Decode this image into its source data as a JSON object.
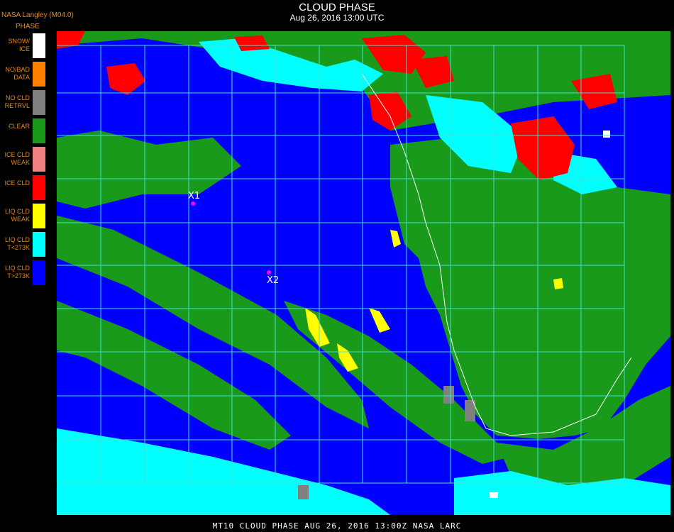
{
  "header": {
    "title": "CLOUD PHASE",
    "date": "Aug 26, 2016 13:00 UTC",
    "source": "NASA Langley (M04.0)"
  },
  "legend": {
    "title": "PHASE",
    "items": [
      {
        "label": "SNOW/\nICE",
        "color": "#ffffff"
      },
      {
        "label": "NO/BAD\nDATA",
        "color": "#ff8000"
      },
      {
        "label": "NO CLD\nRETRVL",
        "color": "#808080"
      },
      {
        "label": "CLEAR",
        "color": "#1a9a1a"
      },
      {
        "label": "ICE CLD\nWEAK",
        "color": "#f08080"
      },
      {
        "label": "ICE CLD",
        "color": "#ff0000"
      },
      {
        "label": "LIQ CLD\nWEAK",
        "color": "#ffff00"
      },
      {
        "label": "LIQ CLD\nT<273K",
        "color": "#00ffff"
      },
      {
        "label": "LIQ CLD\nT>273K",
        "color": "#0000ff"
      }
    ]
  },
  "sites": [
    {
      "label": "X1"
    },
    {
      "label": "X2"
    }
  ],
  "footer": "MT10  CLOUD PHASE   AUG 26, 2016 13:00Z   NASA LARC"
}
